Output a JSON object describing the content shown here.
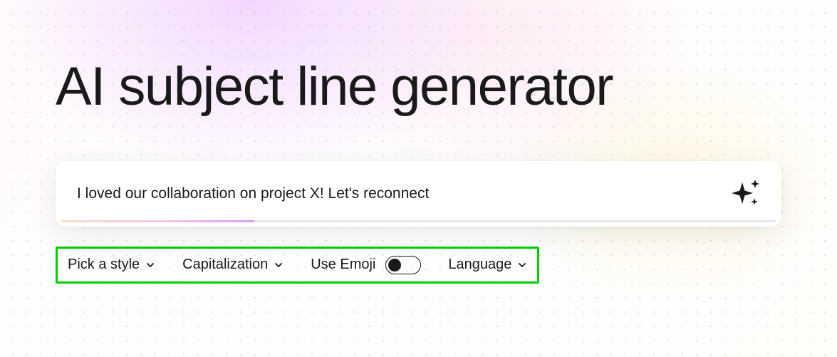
{
  "header": {
    "title": "AI subject line generator"
  },
  "input": {
    "value": "I loved our collaboration on project X! Let's reconnect",
    "placeholder": ""
  },
  "controls": {
    "style": {
      "label": "Pick a style"
    },
    "capitalization": {
      "label": "Capitalization"
    },
    "emoji": {
      "label": "Use Emoji",
      "enabled": false
    },
    "language": {
      "label": "Language"
    }
  },
  "icons": {
    "generate": "sparkle-icon"
  },
  "colors": {
    "highlight_border": "#00d000",
    "text": "#1a1a1a"
  }
}
